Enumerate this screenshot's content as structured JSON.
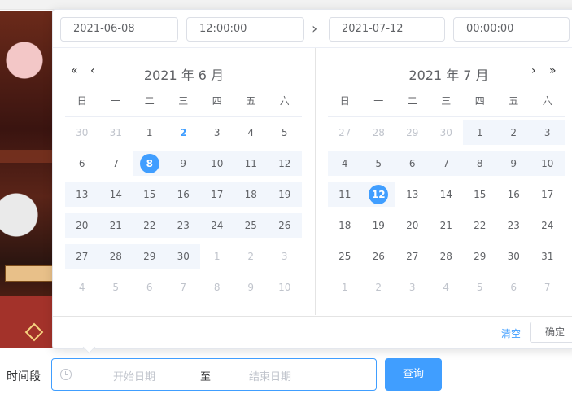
{
  "time_header": {
    "start_date": "2021-06-08",
    "start_time": "12:00:00",
    "end_date": "2021-07-12",
    "end_time": "00:00:00"
  },
  "left_panel": {
    "title": "2021 年 6 月",
    "weekdays": [
      "日",
      "一",
      "二",
      "三",
      "四",
      "五",
      "六"
    ],
    "rows": [
      [
        {
          "d": "30",
          "t": "other"
        },
        {
          "d": "31",
          "t": "other"
        },
        {
          "d": "1"
        },
        {
          "d": "2",
          "t": "today"
        },
        {
          "d": "3"
        },
        {
          "d": "4"
        },
        {
          "d": "5"
        }
      ],
      [
        {
          "d": "6"
        },
        {
          "d": "7"
        },
        {
          "d": "8",
          "t": "sel",
          "r": 1
        },
        {
          "d": "9",
          "r": 1
        },
        {
          "d": "10",
          "r": 1
        },
        {
          "d": "11",
          "r": 1
        },
        {
          "d": "12",
          "r": 1
        }
      ],
      [
        {
          "d": "13",
          "r": 1
        },
        {
          "d": "14",
          "r": 1
        },
        {
          "d": "15",
          "r": 1
        },
        {
          "d": "16",
          "r": 1
        },
        {
          "d": "17",
          "r": 1
        },
        {
          "d": "18",
          "r": 1
        },
        {
          "d": "19",
          "r": 1
        }
      ],
      [
        {
          "d": "20",
          "r": 1
        },
        {
          "d": "21",
          "r": 1
        },
        {
          "d": "22",
          "r": 1
        },
        {
          "d": "23",
          "r": 1
        },
        {
          "d": "24",
          "r": 1
        },
        {
          "d": "25",
          "r": 1
        },
        {
          "d": "26",
          "r": 1
        }
      ],
      [
        {
          "d": "27",
          "r": 1
        },
        {
          "d": "28",
          "r": 1
        },
        {
          "d": "29",
          "r": 1
        },
        {
          "d": "30",
          "r": 1
        },
        {
          "d": "1",
          "t": "other"
        },
        {
          "d": "2",
          "t": "other"
        },
        {
          "d": "3",
          "t": "other"
        }
      ],
      [
        {
          "d": "4",
          "t": "other"
        },
        {
          "d": "5",
          "t": "other"
        },
        {
          "d": "6",
          "t": "other"
        },
        {
          "d": "7",
          "t": "other"
        },
        {
          "d": "8",
          "t": "other"
        },
        {
          "d": "9",
          "t": "other"
        },
        {
          "d": "10",
          "t": "other"
        }
      ]
    ]
  },
  "right_panel": {
    "title": "2021 年 7 月",
    "weekdays": [
      "日",
      "一",
      "二",
      "三",
      "四",
      "五",
      "六"
    ],
    "rows": [
      [
        {
          "d": "27",
          "t": "other"
        },
        {
          "d": "28",
          "t": "other"
        },
        {
          "d": "29",
          "t": "other"
        },
        {
          "d": "30",
          "t": "other"
        },
        {
          "d": "1",
          "r": 1
        },
        {
          "d": "2",
          "r": 1
        },
        {
          "d": "3",
          "r": 1
        }
      ],
      [
        {
          "d": "4",
          "r": 1
        },
        {
          "d": "5",
          "r": 1
        },
        {
          "d": "6",
          "r": 1
        },
        {
          "d": "7",
          "r": 1
        },
        {
          "d": "8",
          "r": 1
        },
        {
          "d": "9",
          "r": 1
        },
        {
          "d": "10",
          "r": 1
        }
      ],
      [
        {
          "d": "11",
          "r": 1
        },
        {
          "d": "12",
          "t": "sel",
          "r": 1
        },
        {
          "d": "13"
        },
        {
          "d": "14"
        },
        {
          "d": "15"
        },
        {
          "d": "16"
        },
        {
          "d": "17"
        }
      ],
      [
        {
          "d": "18"
        },
        {
          "d": "19"
        },
        {
          "d": "20"
        },
        {
          "d": "21"
        },
        {
          "d": "22"
        },
        {
          "d": "23"
        },
        {
          "d": "24"
        }
      ],
      [
        {
          "d": "25"
        },
        {
          "d": "26"
        },
        {
          "d": "27"
        },
        {
          "d": "28"
        },
        {
          "d": "29"
        },
        {
          "d": "30"
        },
        {
          "d": "31"
        }
      ],
      [
        {
          "d": "1",
          "t": "other"
        },
        {
          "d": "2",
          "t": "other"
        },
        {
          "d": "3",
          "t": "other"
        },
        {
          "d": "4",
          "t": "other"
        },
        {
          "d": "5",
          "t": "other"
        },
        {
          "d": "6",
          "t": "other"
        },
        {
          "d": "7",
          "t": "other"
        }
      ]
    ]
  },
  "footer": {
    "clear_label": "清空",
    "ok_label": "确定"
  },
  "form": {
    "label": "时间段",
    "start_placeholder": "开始日期",
    "separator": "至",
    "end_placeholder": "结束日期",
    "query_label": "查询"
  },
  "icons": {
    "double_left": "«",
    "left": "‹",
    "right": "›",
    "double_right": "»",
    "mid_arrow": "›"
  },
  "colors": {
    "accent": "#409eff",
    "range_bg": "#f2f6fc"
  }
}
